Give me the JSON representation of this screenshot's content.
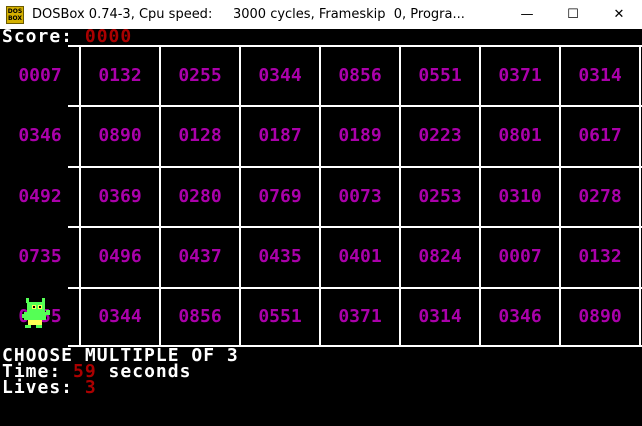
{
  "window": {
    "icon_label": "DOS BOX",
    "title": "DOSBox 0.74-3, Cpu speed:     3000 cycles, Frameskip  0, Progra...",
    "minimize": "—",
    "maximize": "☐",
    "close": "✕"
  },
  "game": {
    "score_label": "Score: ",
    "score_value": "0000",
    "rows": [
      [
        "0007",
        "0132",
        "0255",
        "0344",
        "0856",
        "0551",
        "0371",
        "0314"
      ],
      [
        "0346",
        "0890",
        "0128",
        "0187",
        "0189",
        "0223",
        "0801",
        "0617"
      ],
      [
        "0492",
        "0369",
        "0280",
        "0769",
        "0073",
        "0253",
        "0310",
        "0278"
      ],
      [
        "0735",
        "0496",
        "0437",
        "0435",
        "0401",
        "0824",
        "0007",
        "0132"
      ],
      [
        "0255",
        "0344",
        "0856",
        "0551",
        "0371",
        "0314",
        "0346",
        "0890"
      ]
    ],
    "instruction": "CHOOSE MULTIPLE OF 3",
    "time_label": "Time: ",
    "time_value": "59",
    "time_unit": " seconds",
    "lives_label": "Lives: ",
    "lives_value": "3"
  },
  "colors": {
    "number": "#aa00aa",
    "accent_red": "#aa0000",
    "grid": "#ffffff",
    "background": "#000000"
  }
}
